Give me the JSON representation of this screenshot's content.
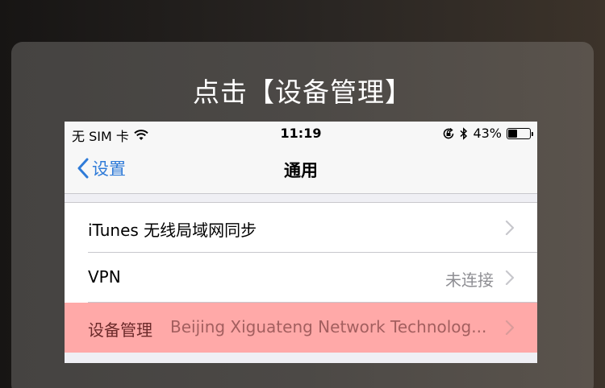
{
  "instruction": "点击【设备管理】",
  "status_bar": {
    "carrier": "无 SIM 卡",
    "time": "11:19",
    "battery_percent": "43%",
    "battery_level": 0.43
  },
  "nav": {
    "back_label": "设置",
    "title": "通用"
  },
  "rows": [
    {
      "label": "iTunes 无线局域网同步",
      "value": ""
    },
    {
      "label": "VPN",
      "value": "未连接"
    },
    {
      "label": "设备管理",
      "value": "Beijing Xiguateng Network Technolog..."
    }
  ],
  "colors": {
    "accent_blue": "#2f7bd8",
    "highlight": "#ffa9a8"
  },
  "icons": [
    "wifi-icon",
    "orientation-lock-icon",
    "bluetooth-icon",
    "battery-icon",
    "back-chevron-icon",
    "chevron-right-icon"
  ]
}
